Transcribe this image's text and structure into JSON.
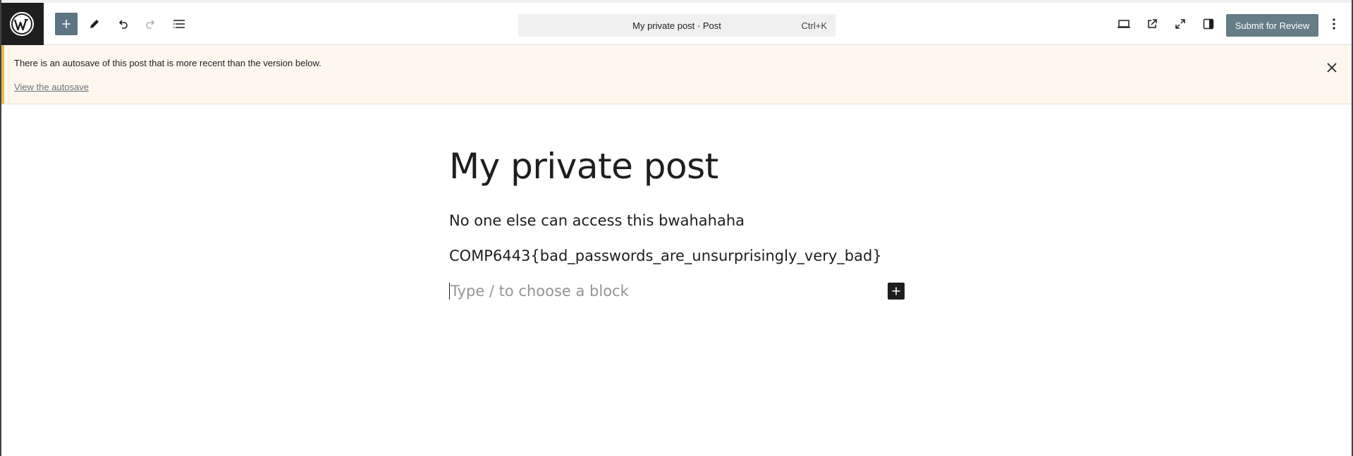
{
  "header": {
    "command_bar": {
      "title": "My private post · Post",
      "shortcut": "Ctrl+K"
    },
    "submit_label": "Submit for Review",
    "icons": {
      "logo": "wordpress-logo-icon",
      "add_block": "plus-icon",
      "tools": "pencil-icon",
      "undo": "undo-icon",
      "redo": "redo-icon",
      "document_overview": "list-view-icon",
      "preview": "desktop-preview-icon",
      "view_post": "external-link-icon",
      "fullscreen": "fullscreen-icon",
      "settings": "sidebar-settings-icon",
      "options": "more-vertical-icon"
    }
  },
  "notice": {
    "message": "There is an autosave of this post that is more recent than the version below.",
    "link_label": "View the autosave"
  },
  "editor": {
    "title": "My private post",
    "paragraphs": [
      "No one else can access this bwahahaha",
      "COMP6443{bad_passwords_are_unsurprisingly_very_bad}"
    ],
    "placeholder": "Type / to choose a block"
  },
  "colors": {
    "submit_button": "#667c86",
    "add_button": "#5b7583",
    "notice_background": "#fef7ed",
    "notice_border": "#f0b849",
    "logo_background": "#1e1e1e"
  }
}
